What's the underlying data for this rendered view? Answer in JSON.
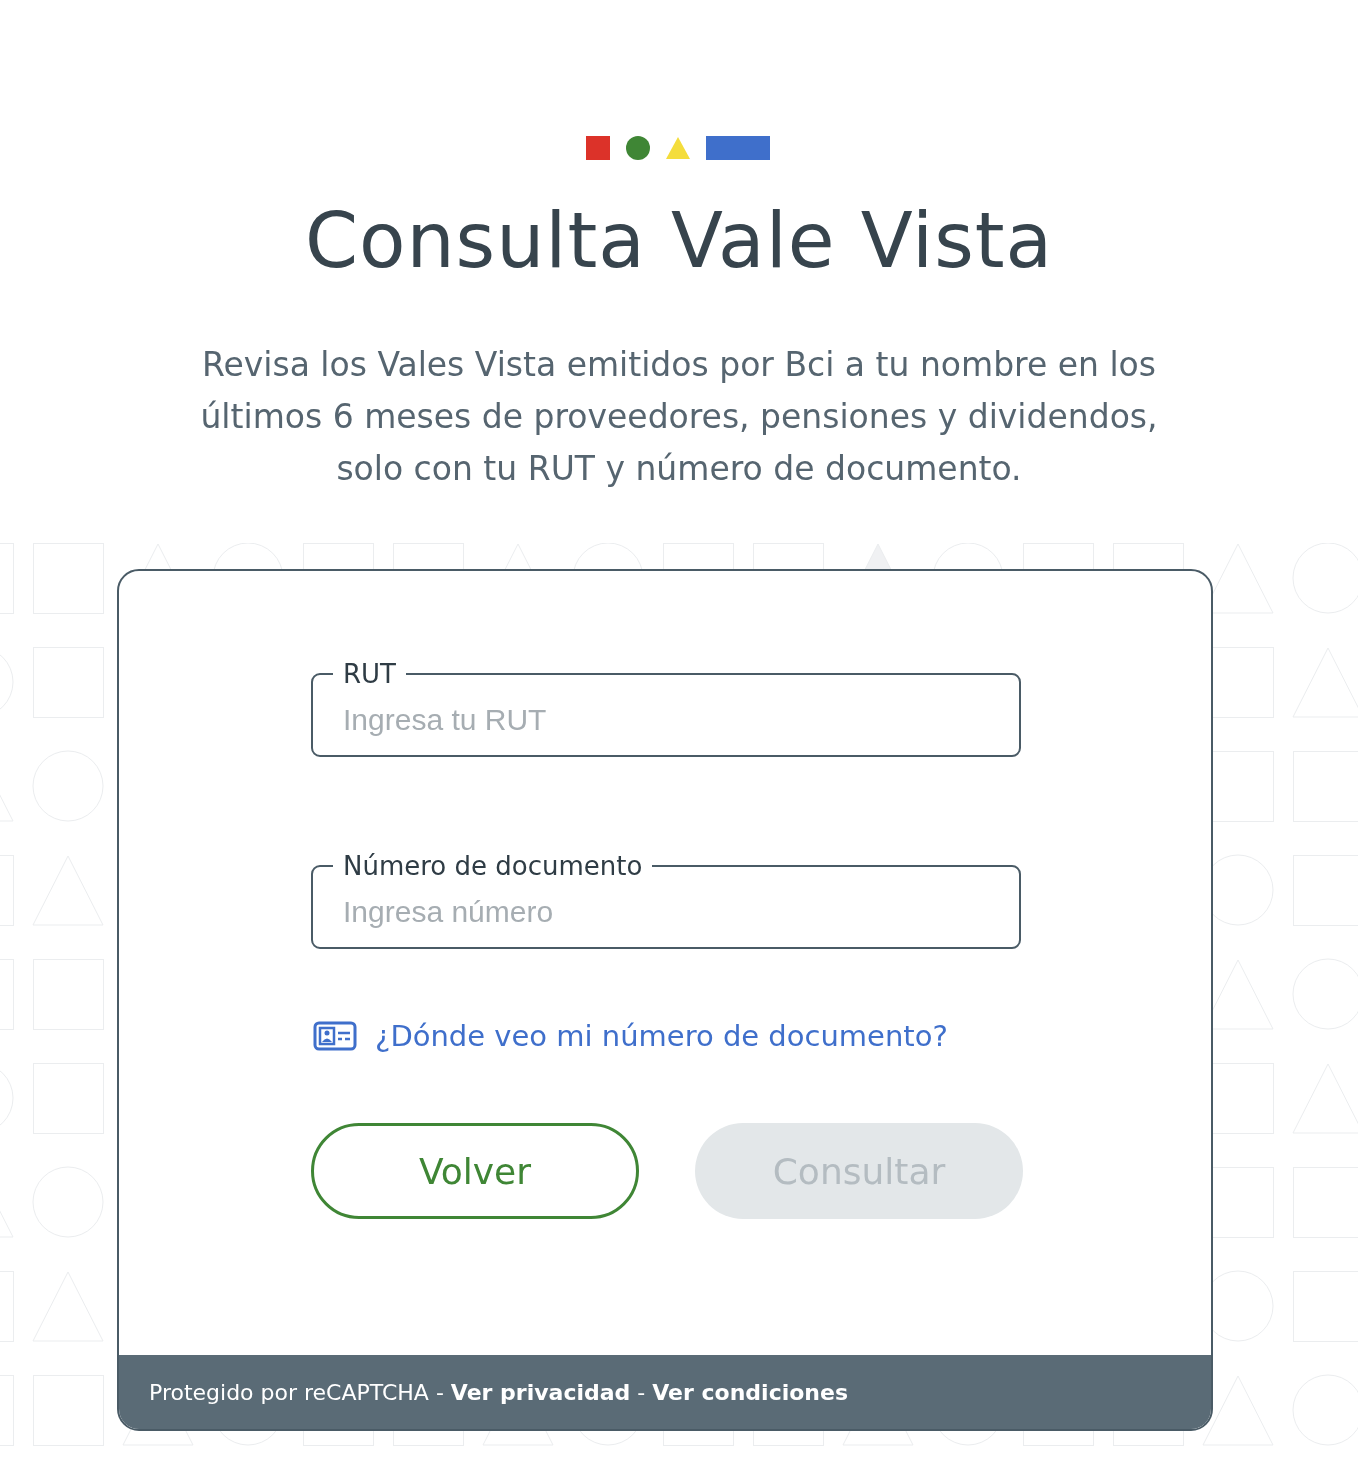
{
  "title": "Consulta Vale Vista",
  "description": "Revisa los Vales Vista emitidos por Bci a tu nombre en los últimos 6 meses de proveedores, pensiones y dividendos, solo con tu RUT y número de documento.",
  "fields": [
    {
      "label": "RUT",
      "placeholder": "Ingresa tu RUT"
    },
    {
      "label": "Número de documento",
      "placeholder": "Ingresa número"
    }
  ],
  "help_link": "¿Dónde veo mi número de documento?",
  "buttons": [
    {
      "label": "Volver",
      "kind": "outline",
      "disabled": false
    },
    {
      "label": "Consultar",
      "kind": "primary",
      "disabled": true
    }
  ],
  "footer": {
    "text": "Protegido por reCAPTCHA",
    "separator": "-",
    "links": [
      "Ver privacidad",
      "Ver condiciones"
    ]
  }
}
